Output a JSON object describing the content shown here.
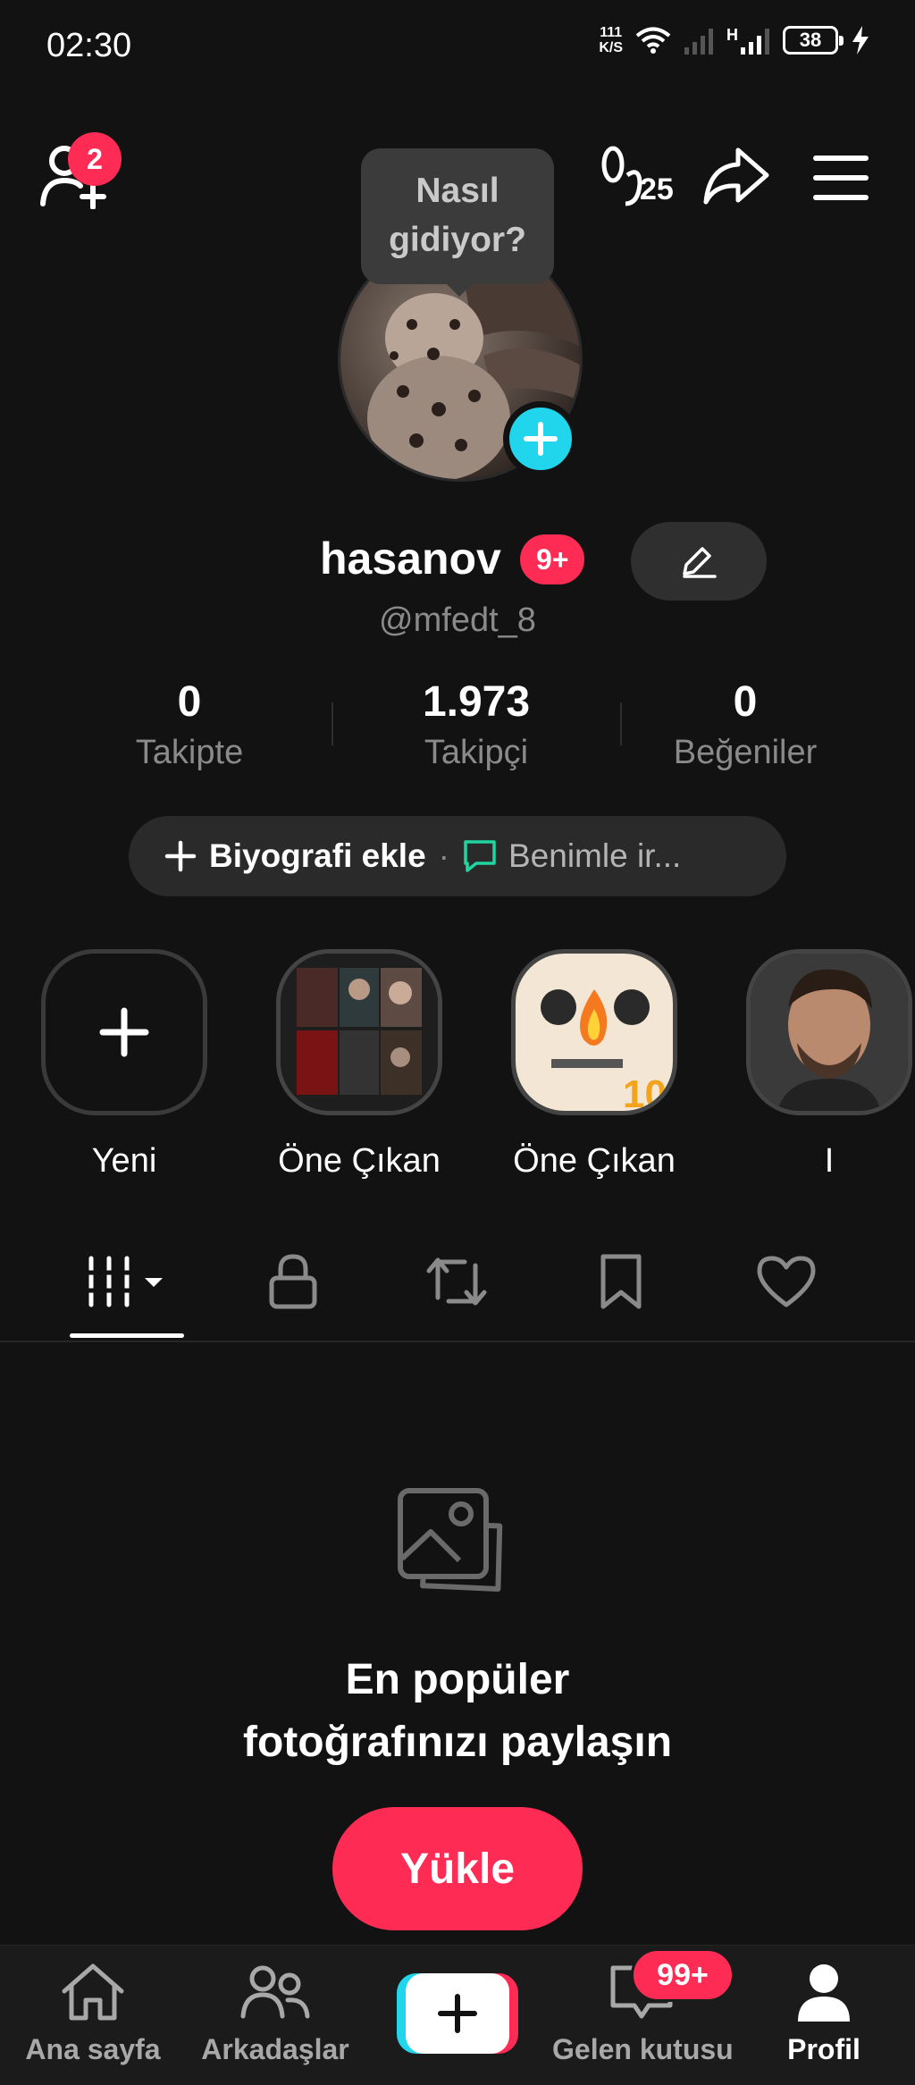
{
  "status_bar": {
    "time": "02:30",
    "net_speed_value": "111",
    "net_speed_unit": "K/S",
    "network_type": "H",
    "battery": "38"
  },
  "header": {
    "add_friends_badge": "2",
    "nearby_count": "25"
  },
  "profile": {
    "tooltip": "Nasıl gidiyor?",
    "display_name": "hasanov",
    "name_badge": "9+",
    "handle": "@mfedt_8"
  },
  "stats": [
    {
      "value": "0",
      "label": "Takipte"
    },
    {
      "value": "1.973",
      "label": "Takipçi"
    },
    {
      "value": "0",
      "label": "Beğeniler"
    }
  ],
  "bio": {
    "add_label": "Biyografi ekle",
    "separator": "·",
    "contact_label": "Benimle ir..."
  },
  "highlights": [
    {
      "label": "Yeni"
    },
    {
      "label": "Öne Çıkan"
    },
    {
      "label": "Öne Çıkan"
    },
    {
      "label": "I"
    }
  ],
  "tabs": [
    "videos-grid-icon",
    "lock-icon",
    "repost-icon",
    "bookmark-icon",
    "heart-icon"
  ],
  "empty_state": {
    "line1": "En popüler",
    "line2": "fotoğrafınızı paylaşın",
    "button": "Yükle"
  },
  "bottom_nav": [
    {
      "label": "Ana sayfa"
    },
    {
      "label": "Arkadaşlar"
    },
    {
      "label": "Gelen kutusu",
      "badge": "99+"
    },
    {
      "label": "Profil"
    }
  ],
  "colors": {
    "accent": "#fe2c55",
    "cyan": "#20d5ec",
    "background": "#121212",
    "muted_text": "#8a8a8a"
  }
}
